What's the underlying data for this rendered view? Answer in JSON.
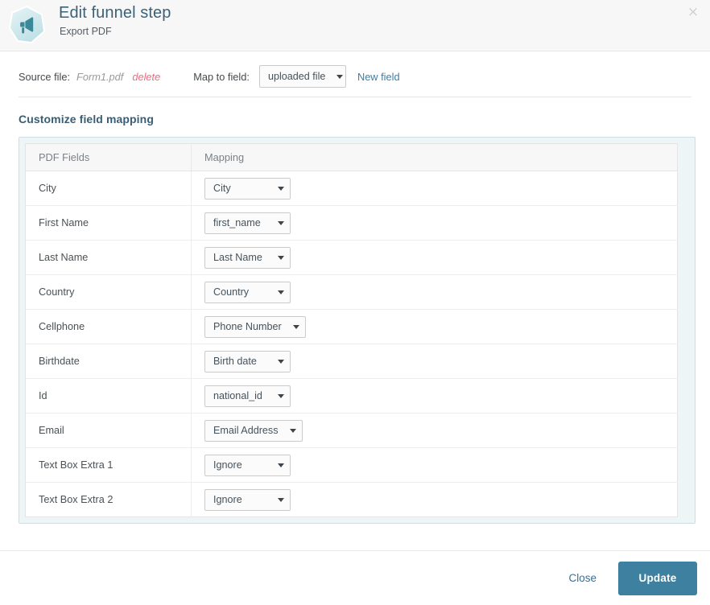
{
  "header": {
    "title": "Edit funnel step",
    "subtitle": "Export PDF",
    "icon": "megaphone-icon",
    "close_icon": "close-icon",
    "close_glyph": "×",
    "background": "#f7f7f7",
    "title_color": "#3b6178"
  },
  "source": {
    "label": "Source file:",
    "filename": "Form1.pdf",
    "delete_label": "delete",
    "delete_color": "#ec6b7e",
    "map_label": "Map to field:",
    "map_value": "uploaded file",
    "new_field_label": "New field",
    "link_color": "#3d7ea3"
  },
  "section": {
    "title": "Customize field mapping",
    "title_color": "#3b5d73",
    "container_border": "#cfdde2",
    "container_fill": "#eef5f7"
  },
  "table": {
    "columns": [
      "PDF Fields",
      "Mapping"
    ],
    "rows": [
      {
        "field": "City",
        "mapping": "City"
      },
      {
        "field": "First Name",
        "mapping": "first_name"
      },
      {
        "field": "Last Name",
        "mapping": "Last Name"
      },
      {
        "field": "Country",
        "mapping": "Country"
      },
      {
        "field": "Cellphone",
        "mapping": "Phone Number"
      },
      {
        "field": "Birthdate",
        "mapping": "Birth date"
      },
      {
        "field": "Id",
        "mapping": "national_id"
      },
      {
        "field": "Email",
        "mapping": "Email Address"
      },
      {
        "field": "Text Box Extra 1",
        "mapping": "Ignore"
      },
      {
        "field": "Text Box Extra 2",
        "mapping": "Ignore"
      }
    ]
  },
  "footer": {
    "close_label": "Close",
    "update_label": "Update",
    "update_color": "#3d80a0",
    "close_color": "#3b6d8c"
  }
}
